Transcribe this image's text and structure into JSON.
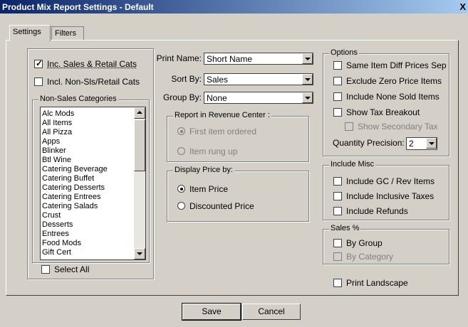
{
  "window": {
    "title": "Product Mix Report Settings - Default",
    "close": "X"
  },
  "tabs": [
    {
      "label": "Settings"
    },
    {
      "label": "Filters"
    }
  ],
  "left": {
    "inc_sales_retail": {
      "label": "Inc. Sales & Retail Cats",
      "checked": true
    },
    "incl_non_sls": {
      "label": "Incl. Non-Sls/Retail Cats",
      "checked": false
    },
    "non_sales_title": "Non-Sales Categories",
    "categories": [
      "Alc Mods",
      "All Items",
      "All Pizza",
      "Apps",
      "Blinker",
      "Btl Wine",
      "Catering Beverage",
      "Catering Buffet",
      "Catering Desserts",
      "Catering Entrees",
      "Catering Salads",
      "Crust",
      "Desserts",
      "Entrees",
      "Food Mods",
      "Gift Cert"
    ],
    "select_all": {
      "label": "Select All",
      "checked": false
    }
  },
  "middle": {
    "print_name": {
      "label": "Print Name:",
      "value": "Short Name"
    },
    "sort_by": {
      "label": "Sort By:",
      "value": "Sales"
    },
    "group_by": {
      "label": "Group By:",
      "value": "None"
    },
    "revenue_center": {
      "title": "Report in Revenue Center :",
      "options": [
        "First item ordered",
        "Item rung up"
      ],
      "selected": 0
    },
    "display_price": {
      "title": "Display Price by:",
      "options": [
        "Item Price",
        "Discounted Price"
      ],
      "selected": 0
    }
  },
  "right": {
    "options_title": "Options",
    "options": [
      {
        "label": "Same Item Diff Prices Sep",
        "checked": false
      },
      {
        "label": "Exclude Zero Price Items",
        "checked": false
      },
      {
        "label": "Include None Sold Items",
        "checked": false
      },
      {
        "label": "Show Tax Breakout",
        "checked": false
      },
      {
        "label": "Show Secondary Tax",
        "checked": false,
        "disabled": true
      }
    ],
    "qty_precision": {
      "label": "Quantity Precision:",
      "value": "2"
    },
    "misc_title": "Include Misc",
    "misc": [
      {
        "label": "Include GC / Rev Items",
        "checked": false
      },
      {
        "label": "Include Inclusive Taxes",
        "checked": false
      },
      {
        "label": "Include Refunds",
        "checked": false
      }
    ],
    "sales_title": "Sales %",
    "sales": [
      {
        "label": "By Group",
        "checked": false
      },
      {
        "label": "By Category",
        "checked": false,
        "disabled": true
      }
    ],
    "print_landscape": {
      "label": "Print Landscape",
      "checked": false
    }
  },
  "buttons": {
    "save": "Save",
    "cancel": "Cancel"
  }
}
